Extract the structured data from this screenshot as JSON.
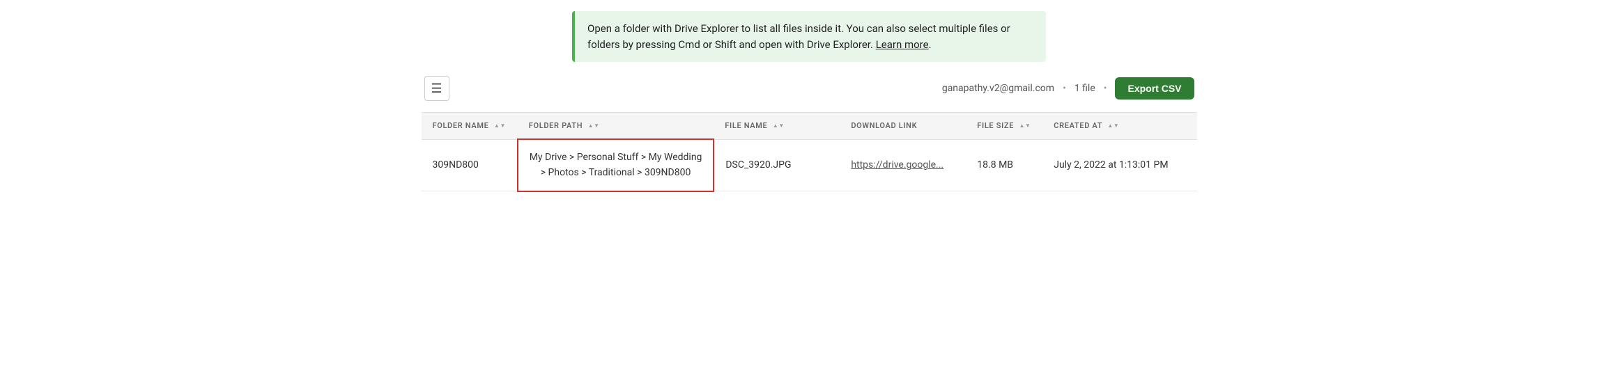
{
  "banner": {
    "text": "Open a folder with Drive Explorer to list all files inside it. You can also select multiple files or folders by pressing Cmd or Shift and open with Drive Explorer.",
    "link_text": "Learn more"
  },
  "toolbar": {
    "hamburger_label": "☰",
    "user_email": "ganapathy.v2@gmail.com",
    "file_count": "1 file",
    "export_button": "Export CSV"
  },
  "table": {
    "headers": [
      {
        "key": "folder-name",
        "label": "FOLDER NAME"
      },
      {
        "key": "folder-path",
        "label": "FOLDER PATH"
      },
      {
        "key": "file-name",
        "label": "FILE NAME"
      },
      {
        "key": "download",
        "label": "DOWNLOAD LINK"
      },
      {
        "key": "file-size",
        "label": "FILE SIZE"
      },
      {
        "key": "created-at",
        "label": "CREATED AT"
      }
    ],
    "rows": [
      {
        "folder_name": "309ND800",
        "folder_path": "My Drive > Personal Stuff > My Wedding > Photos > Traditional > 309ND800",
        "file_name": "DSC_3920.JPG",
        "download_link": "https://drive.google...",
        "file_size": "18.8 MB",
        "created_at": "July 2, 2022 at 1:13:01 PM"
      }
    ]
  }
}
